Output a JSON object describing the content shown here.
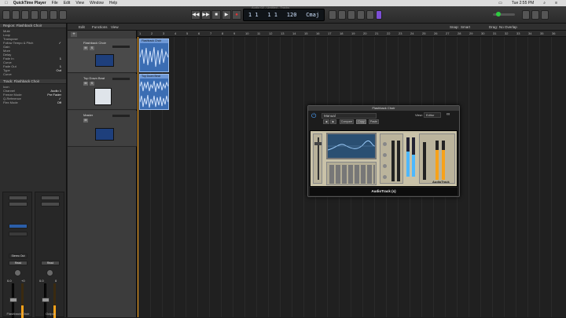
{
  "menubar": {
    "app": "QuickTime Player",
    "items": [
      "File",
      "Edit",
      "View",
      "Window",
      "Help"
    ],
    "clock": "Tue 2:55 PM"
  },
  "toolbar": {
    "window_title": "Audio 02 - Untitled - Tracks",
    "lcd": [
      "1 1",
      "1 1",
      "120",
      "Cmaj"
    ]
  },
  "inspector": {
    "region_header": "Region: Flashback Choir",
    "region_rows": [
      [
        "Mute",
        ""
      ],
      [
        "Loop",
        ""
      ],
      [
        "Transpose",
        ""
      ],
      [
        "Follow Tempo & Pitch",
        "✓"
      ],
      [
        "Gain",
        ""
      ],
      [
        "More",
        ""
      ],
      [
        "Delay",
        ""
      ],
      [
        "Fade In",
        "1"
      ],
      [
        "Curve",
        ""
      ],
      [
        "Fade Out",
        "1"
      ],
      [
        "Type",
        "Out"
      ],
      [
        "Curve",
        ""
      ]
    ],
    "track_header": "Track: Flashback Choir",
    "track_rows": [
      [
        "Icon",
        ""
      ],
      [
        "Channel",
        "Audio 1"
      ],
      [
        "Freeze Mode",
        "Pre Fader"
      ],
      [
        "Q-Reference",
        "✓"
      ],
      [
        "Flex Mode",
        "Off"
      ]
    ],
    "strips": [
      {
        "name": "Flashback Choir",
        "volume": "0.0",
        "pan": "+0",
        "bus": "Stereo Out",
        "mode": "Read"
      },
      {
        "name": "Output",
        "volume": "0.0",
        "pan": "0",
        "bus": "",
        "mode": "Read"
      }
    ]
  },
  "tracks_bar": {
    "edit": "Edit",
    "functions": "Functions",
    "view": "View",
    "snap_label": "Snap:",
    "snap_value": "Smart",
    "drag_label": "Drag:",
    "drag_value": "No Overlap"
  },
  "ruler": [
    "1",
    "2",
    "3",
    "4",
    "5",
    "6",
    "7",
    "8",
    "9",
    "10",
    "11",
    "12",
    "13",
    "14",
    "15",
    "16",
    "17",
    "18",
    "19",
    "20",
    "21",
    "22",
    "23",
    "24",
    "25",
    "26",
    "27",
    "28",
    "29",
    "30",
    "31",
    "32",
    "33",
    "34",
    "35",
    "36"
  ],
  "tracks": [
    {
      "name": "Flashback Choir",
      "mute": "M",
      "solo": "S"
    },
    {
      "name": "Top Down Beat",
      "mute": "M",
      "solo": "S"
    },
    {
      "name": "Master",
      "mute": "M",
      "solo": ""
    }
  ],
  "regions": [
    {
      "title": "Flashback Choir"
    },
    {
      "title": "Top Down Beat"
    }
  ],
  "plugin": {
    "title": "Flashback Choir",
    "preset": "Manual",
    "buttons": [
      "◀",
      "▶",
      "Compare",
      "Copy",
      "Paste"
    ],
    "view_label": "View:",
    "view_value": "Editor",
    "footer": "AudioTrack (s)",
    "brand": "AudioTrack"
  },
  "colors": {
    "accent_orange": "#f7a21a",
    "region_blue": "#3b6db3",
    "thumb_blue": "#1e3f7c"
  }
}
